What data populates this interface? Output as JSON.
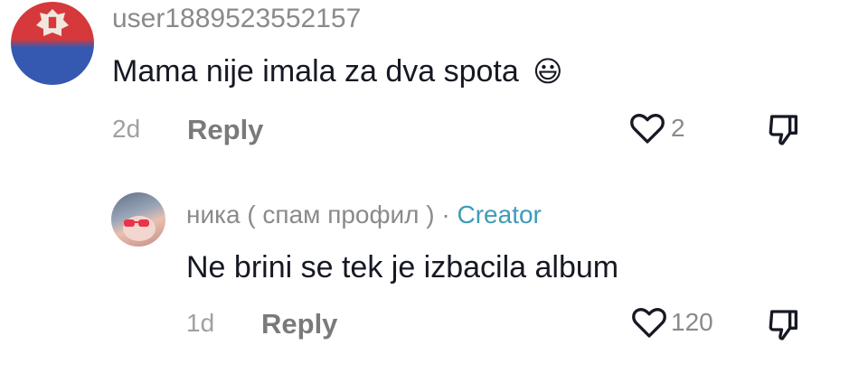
{
  "comments": [
    {
      "username": "user1889523552157",
      "text": "Mama nije imala za dva spota",
      "emoji": "😃",
      "time": "2d",
      "reply_label": "Reply",
      "like_count": "2",
      "avatar": {
        "top_color": "#d6393b",
        "bottom_color": "#3559b0",
        "emblem": "serbian-eagle"
      }
    },
    {
      "username": "ника ( спам профил )",
      "separator": "·",
      "badge": "Creator",
      "text": "Ne brini se tek je izbacila album",
      "time": "1d",
      "reply_label": "Reply",
      "like_count": "120",
      "avatar": {
        "style": "photo"
      }
    }
  ],
  "colors": {
    "username": "#8a8a8a",
    "text": "#161823",
    "creator_badge": "#3d9bb8",
    "icon": "#161823"
  }
}
